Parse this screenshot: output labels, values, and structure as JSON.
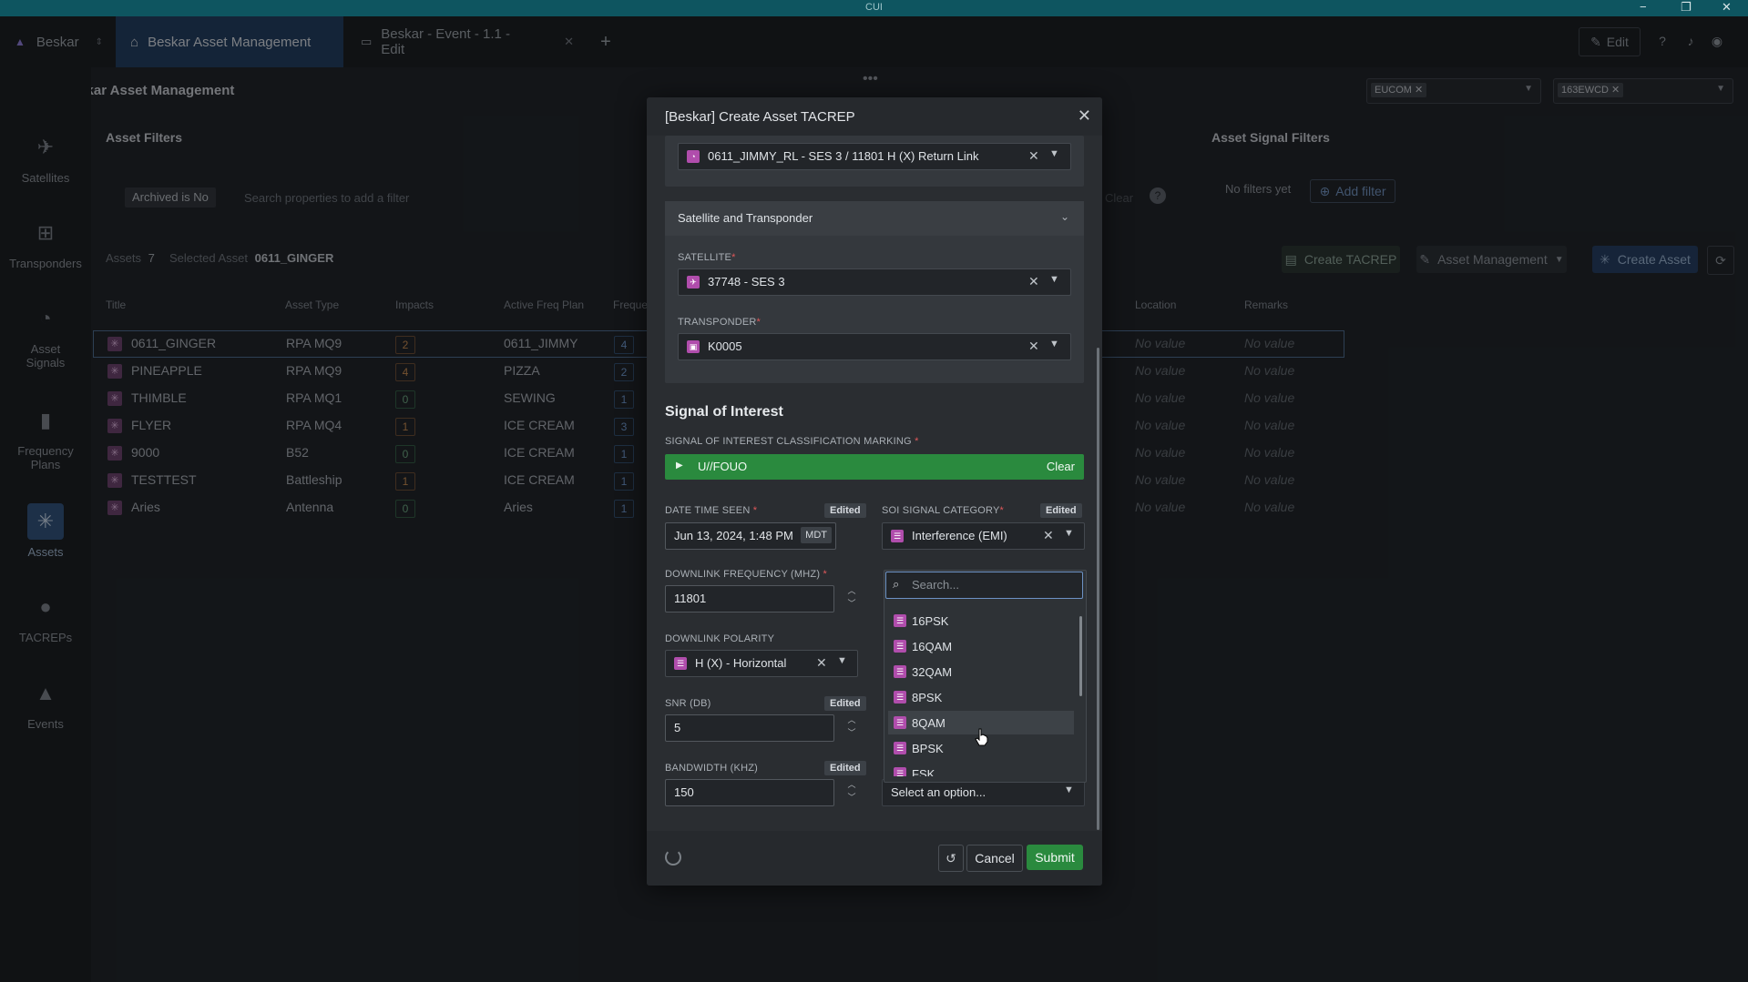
{
  "titlebar": {
    "caption": "CUI",
    "minimize_icon": "−",
    "restore_icon": "❐",
    "close_icon": "✕"
  },
  "tabs": {
    "workspace": "Beskar",
    "active": "Beskar Asset Management",
    "second": "Beskar - Event - 1.1 - Edit",
    "edit_label": "Edit"
  },
  "app": {
    "title": "Beskar Asset Management",
    "tags": [
      "EUCOM",
      "163EWCD"
    ]
  },
  "sidebar": {
    "items": [
      {
        "label": "Satellites",
        "icon": "satellite-icon"
      },
      {
        "label": "Transponders",
        "icon": "transponder-icon"
      },
      {
        "label": "Asset Signals",
        "icon": "rss-icon"
      },
      {
        "label": "Frequency Plans",
        "icon": "frequency-icon"
      },
      {
        "label": "Assets",
        "icon": "asterisk-icon"
      },
      {
        "label": "TACREPs",
        "icon": "tacrep-icon"
      },
      {
        "label": "Events",
        "icon": "warning-icon"
      }
    ]
  },
  "asset_filters": {
    "heading": "Asset Filters",
    "chip": "Archived is No",
    "placeholder": "Search properties to add a filter",
    "clear": "Clear"
  },
  "signal_filters": {
    "heading": "Asset Signal Filters",
    "empty": "No filters yet",
    "add": "Add filter"
  },
  "assets_bar": {
    "assets_label": "Assets",
    "assets_count": "7",
    "selected_label": "Selected Asset",
    "selected_value": "0611_GINGER",
    "create_tacrep": "Create TACREP",
    "asset_management": "Asset Management",
    "create_asset": "Create Asset"
  },
  "table": {
    "headers": [
      "Title",
      "Asset Type",
      "Impacts",
      "Active Freq Plan",
      "Freque",
      "Location",
      "Remarks"
    ],
    "no_value": "No value",
    "rows": [
      {
        "title": "0611_GINGER",
        "type": "RPA MQ9",
        "impacts": "2",
        "impacts_color": "orange",
        "plan": "0611_JIMMY",
        "freq": "4"
      },
      {
        "title": "PINEAPPLE",
        "type": "RPA MQ9",
        "impacts": "4",
        "impacts_color": "orange",
        "plan": "PIZZA",
        "freq": "2"
      },
      {
        "title": "THIMBLE",
        "type": "RPA MQ1",
        "impacts": "0",
        "impacts_color": "green",
        "plan": "SEWING",
        "freq": "1"
      },
      {
        "title": "FLYER",
        "type": "RPA MQ4",
        "impacts": "1",
        "impacts_color": "orange",
        "plan": "ICE CREAM",
        "freq": "3"
      },
      {
        "title": "9000",
        "type": "B52",
        "impacts": "0",
        "impacts_color": "green",
        "plan": "ICE CREAM",
        "freq": "1"
      },
      {
        "title": "TESTTEST",
        "type": "Battleship",
        "impacts": "1",
        "impacts_color": "orange",
        "plan": "ICE CREAM",
        "freq": "1"
      },
      {
        "title": "Aries",
        "type": "Antenna",
        "impacts": "0",
        "impacts_color": "green",
        "plan": "Aries",
        "freq": "1"
      }
    ]
  },
  "modal": {
    "title": "[Beskar] Create Asset TACREP",
    "asset_signal": "0611_JIMMY_RL - SES 3 / 11801 H (X) Return Link",
    "sat_section": "Satellite and Transponder",
    "satellite_label": "SATELLITE",
    "satellite_value": "37748 - SES 3",
    "transponder_label": "TRANSPONDER",
    "transponder_value": "K0005",
    "soi_heading": "Signal of Interest",
    "marking_label": "SIGNAL OF INTEREST CLASSIFICATION MARKING",
    "marking_value": "U//FOUO",
    "marking_clear": "Clear",
    "marking_color": "#2a8a3e",
    "dts_label": "DATE TIME SEEN",
    "dts_value": "Jun 13, 2024, 1:48 PM",
    "dts_tz": "MDT",
    "edited": "Edited",
    "category_label": "SOI SIGNAL CATEGORY",
    "category_value": "Interference (EMI)",
    "downlink_freq_label": "DOWNLINK FREQUENCY (MHZ)",
    "downlink_freq_value": "11801",
    "polarity_label": "DOWNLINK POLARITY",
    "polarity_value": "H (X) - Horizontal",
    "snr_label": "SNR (DB)",
    "snr_value": "5",
    "bandwidth_label": "BANDWIDTH (KHZ)",
    "bandwidth_value": "150",
    "modulation_placeholder": "Select an option...",
    "search_placeholder": "Search...",
    "options": [
      "16PSK",
      "16QAM",
      "32QAM",
      "8PSK",
      "8QAM",
      "BPSK",
      "FSK"
    ],
    "hovered_option": "8QAM",
    "cancel": "Cancel",
    "submit": "Submit",
    "submit_color": "#2a8a3e"
  }
}
